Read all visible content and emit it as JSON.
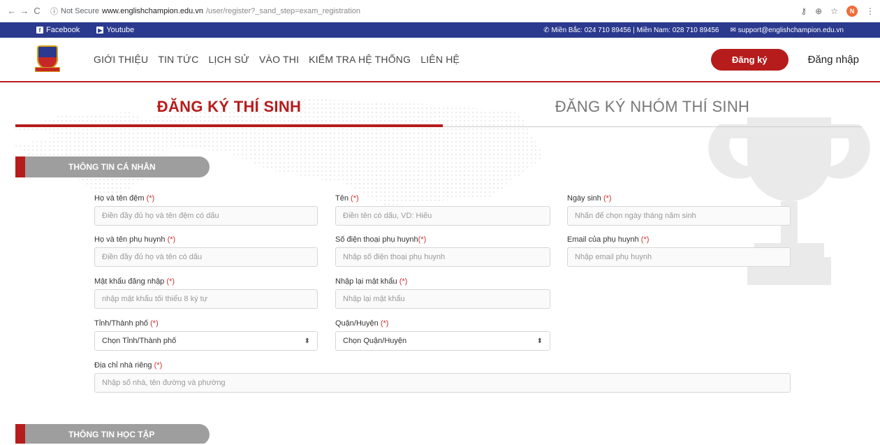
{
  "browser": {
    "not_secure": "Not Secure",
    "domain": "www.englishchampion.edu.vn",
    "path": "/user/register?_sand_step=exam_registration",
    "avatar": "N"
  },
  "topbar": {
    "facebook": "Facebook",
    "youtube": "Youtube",
    "phone": "Miền Bắc: 024 710 89456 | Miền Nam: 028 710 89456",
    "email": "support@englishchampion.edu.vn"
  },
  "nav": {
    "items": [
      "GIỚI THIỆU",
      "TIN TỨC",
      "LỊCH SỬ",
      "VÀO THI",
      "KIỂM TRA HỆ THỐNG",
      "LIÊN HỆ"
    ],
    "register": "Đăng ký",
    "login": "Đăng nhập"
  },
  "tabs": {
    "individual": "ĐĂNG KÝ THÍ SINH",
    "group": "ĐĂNG KÝ NHÓM THÍ SINH"
  },
  "sections": {
    "personal": "THÔNG TIN CÁ NHÂN",
    "study": "THÔNG TIN HỌC TẬP"
  },
  "required_mark": "(*)",
  "form": {
    "lastname_label": "Họ và tên đệm",
    "lastname_ph": "Điền đầy đủ họ và tên đệm có dấu",
    "firstname_label": "Tên",
    "firstname_ph": "Điền tên có dấu, VD: Hiếu",
    "dob_label": "Ngày sinh",
    "dob_ph": "Nhấn để chọn ngày tháng năm sinh",
    "parent_label": "Họ và tên phụ huynh",
    "parent_ph": "Điền đầy đủ họ và tên có dấu",
    "parent_phone_label": "Số điện thoại phụ huynh",
    "parent_phone_ph": "Nhập số điện thoại phụ huynh",
    "parent_email_label": "Email của phụ huynh",
    "parent_email_ph": "Nhập email phụ huynh",
    "password_label": "Mật khẩu đăng nhập",
    "password_ph": "nhập mật khẩu tối thiểu 8 ký tự",
    "password2_label": "Nhập lại mật khẩu",
    "password2_ph": "Nhập lại mật khẩu",
    "province_label": "Tỉnh/Thành phố",
    "province_value": "Chọn Tỉnh/Thành phố",
    "district_label": "Quận/Huyện",
    "district_value": "Chọn Quận/Huyện",
    "address_label": "Địa chỉ nhà riêng",
    "address_ph": "Nhập số nhà, tên đường và phường"
  }
}
